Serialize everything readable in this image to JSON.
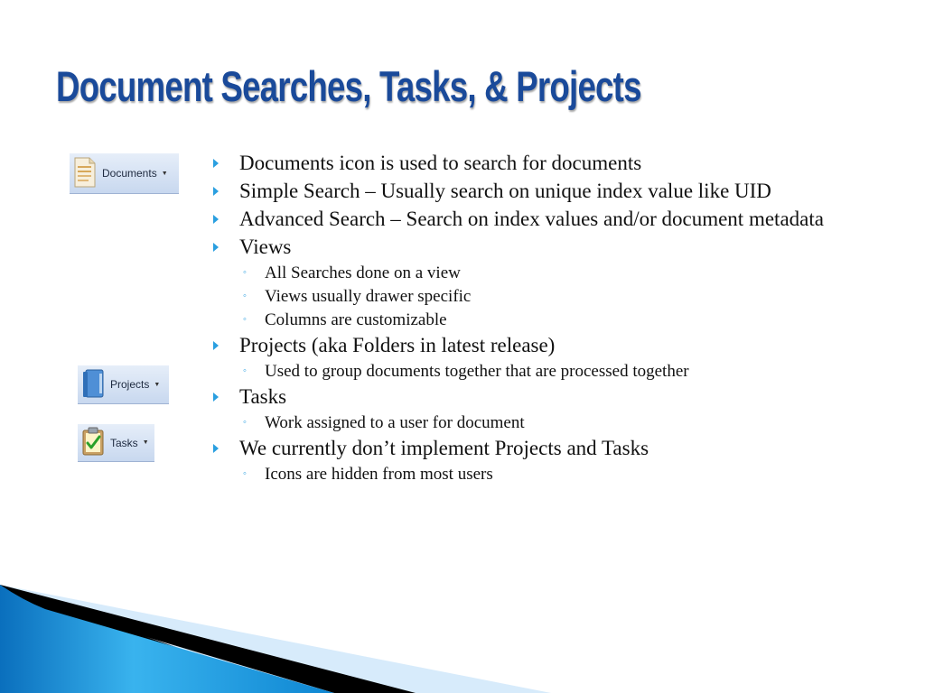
{
  "slide": {
    "title": "Document Searches, Tasks, & Projects"
  },
  "ribbon_buttons": {
    "documents": {
      "label": "Documents",
      "icon": "document-icon"
    },
    "projects": {
      "label": "Projects",
      "icon": "binder-icon"
    },
    "tasks": {
      "label": "Tasks",
      "icon": "clipboard-check-icon"
    }
  },
  "bullets": [
    {
      "text": "Documents icon is used to search for documents",
      "sub": []
    },
    {
      "text": "Simple Search – Usually search on unique index value like UID",
      "sub": []
    },
    {
      "text": "Advanced Search – Search on index values and/or document metadata",
      "sub": []
    },
    {
      "text": "Views",
      "sub": [
        "All Searches done on a view",
        "Views usually drawer specific",
        "Columns are customizable"
      ]
    },
    {
      "text": "Projects (aka Folders in latest release)",
      "sub": [
        "Used to group documents together that are processed together"
      ]
    },
    {
      "text": "Tasks",
      "sub": [
        "Work assigned to a user for document"
      ]
    },
    {
      "text": "We currently don’t implement Projects and Tasks",
      "sub": [
        "Icons are hidden from most users"
      ]
    }
  ],
  "colors": {
    "title": "#1a4a9a",
    "bullet_marker": "#2a9fe0",
    "swoosh_blue": "#1a8ad6"
  }
}
